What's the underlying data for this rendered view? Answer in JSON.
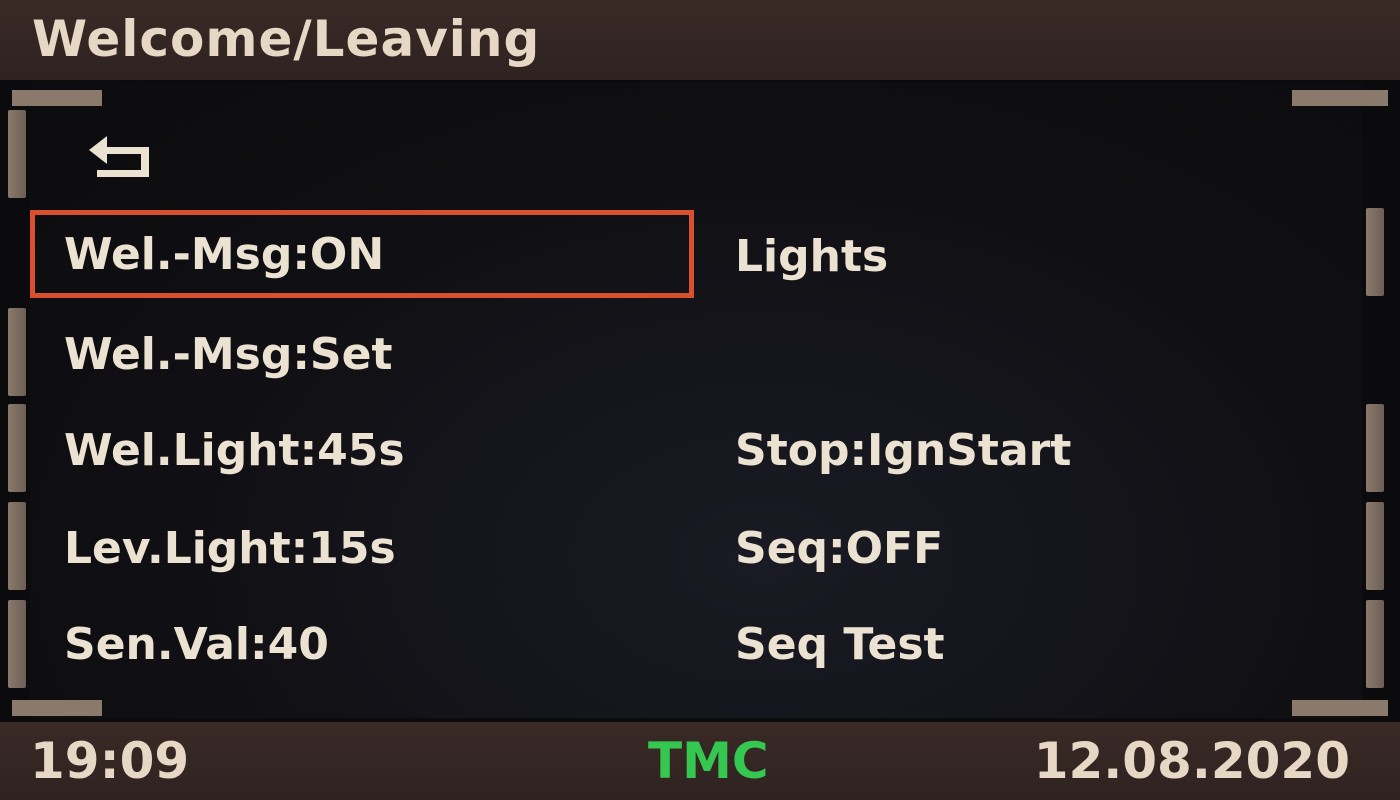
{
  "header": {
    "title": "Welcome/Leaving"
  },
  "nav": {
    "back_icon": "back-arrow-icon"
  },
  "menu": {
    "left": [
      {
        "label": "Wel.-Msg:ON",
        "selected": true
      },
      {
        "label": "Wel.-Msg:Set"
      },
      {
        "label": "Wel.Light:45s"
      },
      {
        "label": "Lev.Light:15s"
      },
      {
        "label": "Sen.Val:40"
      }
    ],
    "right": [
      {
        "label": "Lights"
      },
      {
        "label": "Stop:IgnStart"
      },
      {
        "label": "Seq:OFF"
      },
      {
        "label": "Seq Test"
      }
    ]
  },
  "status": {
    "time": "19:09",
    "tmc": "TMC",
    "date": "12.08.2020"
  },
  "colors": {
    "selection": "#d9502e",
    "text": "#ece2d2",
    "tmc": "#35c850",
    "bar": "#2e2220"
  }
}
